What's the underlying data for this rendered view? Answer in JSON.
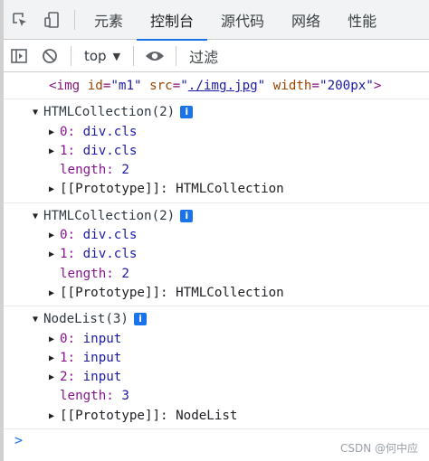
{
  "tabs": [
    {
      "label": "元素"
    },
    {
      "label": "控制台"
    },
    {
      "label": "源代码"
    },
    {
      "label": "网络"
    },
    {
      "label": "性能"
    }
  ],
  "toolbar": {
    "context": "top",
    "filter_placeholder": "过滤"
  },
  "console": {
    "img_line": {
      "open": "<img",
      "attr1": "id",
      "val1": "\"m1\"",
      "attr2": "src",
      "val2_q1": "\"",
      "val2_link": "./img.jpg",
      "val2_q2": "\"",
      "attr3": "width",
      "val3": "\"200px\"",
      "close": ">"
    },
    "groups": [
      {
        "header": "HTMLCollection(2)",
        "items": [
          {
            "key": "0",
            "value": "div.cls"
          },
          {
            "key": "1",
            "value": "div.cls"
          }
        ],
        "length_key": "length",
        "length_value": "2",
        "proto_key": "[[Prototype]]",
        "proto_value": "HTMLCollection"
      },
      {
        "header": "HTMLCollection(2)",
        "items": [
          {
            "key": "0",
            "value": "div.cls"
          },
          {
            "key": "1",
            "value": "div.cls"
          }
        ],
        "length_key": "length",
        "length_value": "2",
        "proto_key": "[[Prototype]]",
        "proto_value": "HTMLCollection"
      },
      {
        "header": "NodeList(3)",
        "items": [
          {
            "key": "0",
            "value": "input"
          },
          {
            "key": "1",
            "value": "input"
          },
          {
            "key": "2",
            "value": "input"
          }
        ],
        "length_key": "length",
        "length_value": "3",
        "proto_key": "[[Prototype]]",
        "proto_value": "NodeList"
      }
    ],
    "prompt": ">"
  },
  "watermark": "CSDN @何中应",
  "icons": {
    "inspect": "inspect-element-icon",
    "device": "device-toolbar-icon",
    "sidebar": "show-sidebar-icon",
    "clear": "clear-console-icon",
    "eye": "live-expression-icon",
    "info": "info-icon"
  },
  "colors": {
    "accent": "#1a73e8",
    "key_purple": "#881391",
    "value_navy": "#1a1aa6"
  }
}
